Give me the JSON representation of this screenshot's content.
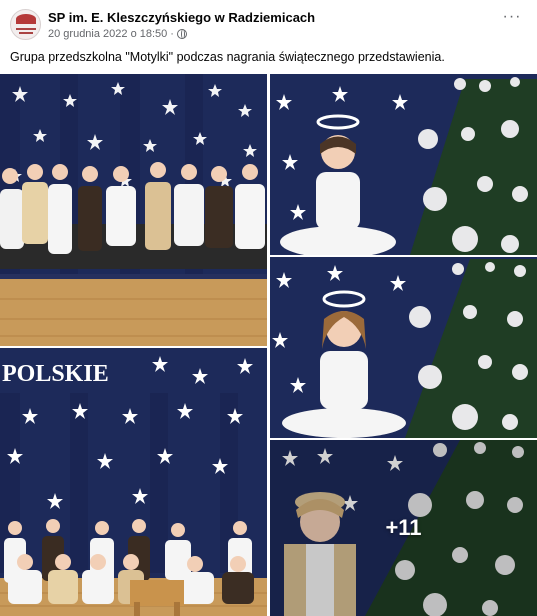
{
  "post": {
    "page_name": "SP im. E. Kleszczyńskiego w Radziemicach",
    "date": "20 grudnia 2022 o 18:50",
    "separator": "·",
    "more_label": "···",
    "caption": "Grupa przedszkolna \"Motylki\" podczas nagrania świątecznego przedstawienia."
  },
  "gallery": {
    "banner_text": "POLSKIE",
    "extra_photos_label": "+11"
  },
  "colors": {
    "backdrop": "#1d2a5a",
    "floor": "#c89a5a",
    "tree": "#1f3d24",
    "ornament": "#e8e8ea"
  },
  "icons": [
    "globe-icon",
    "more-options-icon",
    "page-avatar"
  ]
}
